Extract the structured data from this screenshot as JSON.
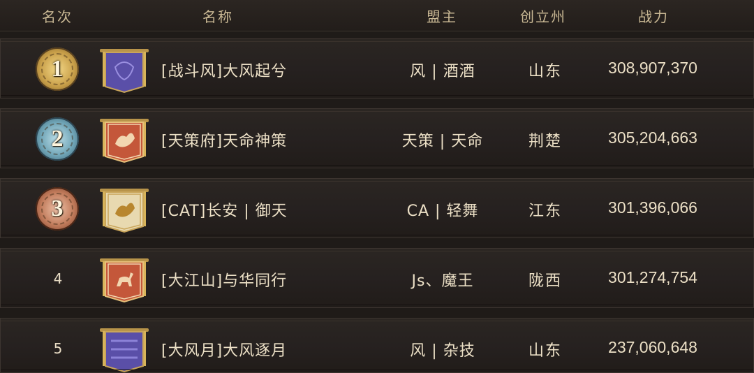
{
  "header": {
    "rank": "名次",
    "name": "名称",
    "leader": "盟主",
    "state": "创立州",
    "power": "战力"
  },
  "rows": [
    {
      "rank": "1",
      "medal": "gold",
      "banner_color": "#5a4fa8",
      "banner_icon": "crest-icon",
      "name": "[战斗风]大风起兮",
      "leader": "风 | 酒酒",
      "state": "山东",
      "power": "308,907,370"
    },
    {
      "rank": "2",
      "medal": "silver",
      "banner_color": "#c4573a",
      "banner_icon": "phoenix-icon",
      "name": "[天策府]天命神策",
      "leader": "天策 | 天命",
      "state": "荆楚",
      "power": "305,204,663"
    },
    {
      "rank": "3",
      "medal": "bronze",
      "banner_color": "#e8d9b0",
      "banner_icon": "phoenix-icon",
      "name": "[CAT]长安 | 御天",
      "leader": "CA | 轻舞",
      "state": "江东",
      "power": "301,396,066"
    },
    {
      "rank": "4",
      "medal": "",
      "banner_color": "#c4573a",
      "banner_icon": "deer-icon",
      "name": "[大江山]与华同行",
      "leader": "Js、魔王",
      "state": "陇西",
      "power": "301,274,754"
    },
    {
      "rank": "5",
      "medal": "",
      "banner_color": "#5a4fa8",
      "banner_icon": "pattern-icon",
      "name": "[大风月]大风逐月",
      "leader": "风 | 杂技",
      "state": "山东",
      "power": "237,060,648"
    }
  ]
}
